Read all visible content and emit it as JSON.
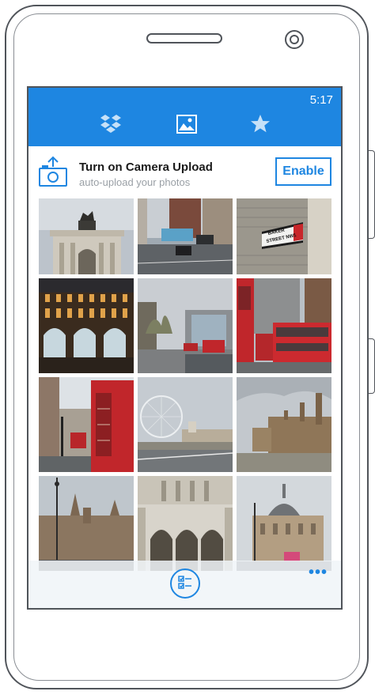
{
  "status_bar": {
    "time": "5:17"
  },
  "tabs": [
    {
      "icon": "dropbox-icon",
      "selected": false
    },
    {
      "icon": "photos-icon",
      "selected": true
    },
    {
      "icon": "favorites-star-icon",
      "selected": false
    }
  ],
  "banner": {
    "title": "Turn on Camera Upload",
    "subtitle": "auto-upload your photos",
    "button_label": "Enable",
    "icon": "camera-upload-icon"
  },
  "photos": [
    {
      "name": "photo-wellington-arch"
    },
    {
      "name": "photo-street-traffic"
    },
    {
      "name": "photo-baker-street-sign",
      "sign_text_1": "BAKER",
      "sign_text_2": "STREET NW1"
    },
    {
      "name": "photo-ornate-building-night"
    },
    {
      "name": "photo-street-buses"
    },
    {
      "name": "photo-red-buses"
    },
    {
      "name": "photo-red-phone-box"
    },
    {
      "name": "photo-london-eye"
    },
    {
      "name": "photo-parliament-river"
    },
    {
      "name": "photo-westminster-abbey"
    },
    {
      "name": "photo-gothic-facade"
    },
    {
      "name": "photo-domed-building"
    }
  ],
  "app_bar": {
    "select_icon": "select-checklist-icon",
    "more_label": "•••"
  },
  "colors": {
    "accent": "#1e86e1"
  }
}
